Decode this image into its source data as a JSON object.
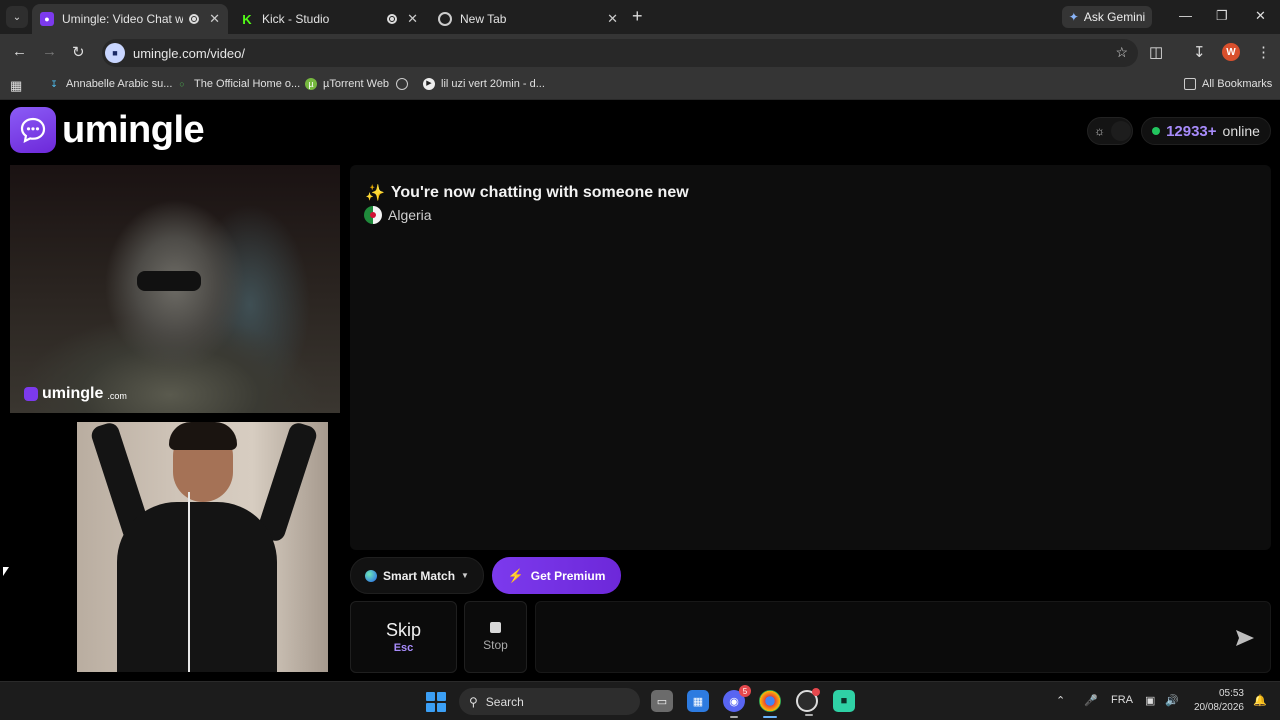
{
  "browser": {
    "tabs": [
      {
        "title": "Umingle: Video Chat with St",
        "active": true
      },
      {
        "title": "Kick - Studio",
        "active": false
      },
      {
        "title": "New Tab",
        "active": false
      }
    ],
    "ask_gemini": "Ask Gemini",
    "url": "umingle.com/video/",
    "profile_initial": "W",
    "bookmarks": [
      "Annabelle Arabic su...",
      "The Official Home o...",
      "µTorrent Web",
      "lil uzi vert 20min - d..."
    ],
    "all_bookmarks": "All Bookmarks"
  },
  "site": {
    "logo_text": "umingle",
    "online_count": "12933+",
    "online_label": "online"
  },
  "remote": {
    "watermark": "umingle",
    "watermark_domain": ".com"
  },
  "chat": {
    "status_emoji": "✨",
    "status": "You're now chatting with someone new",
    "country": "Algeria"
  },
  "controls": {
    "smart_match": "Smart Match",
    "premium": "Get Premium",
    "skip_label": "Skip",
    "skip_key": "Esc",
    "stop_label": "Stop",
    "message_placeholder": ""
  },
  "taskbar": {
    "search_label": "Search",
    "discord_badge": "5",
    "language": "FRA",
    "time": "05:53",
    "date": "20/08/2026"
  },
  "colors": {
    "accent": "#7c3aed",
    "online_dot": "#22c55e",
    "online_count": "#a78bfa"
  }
}
